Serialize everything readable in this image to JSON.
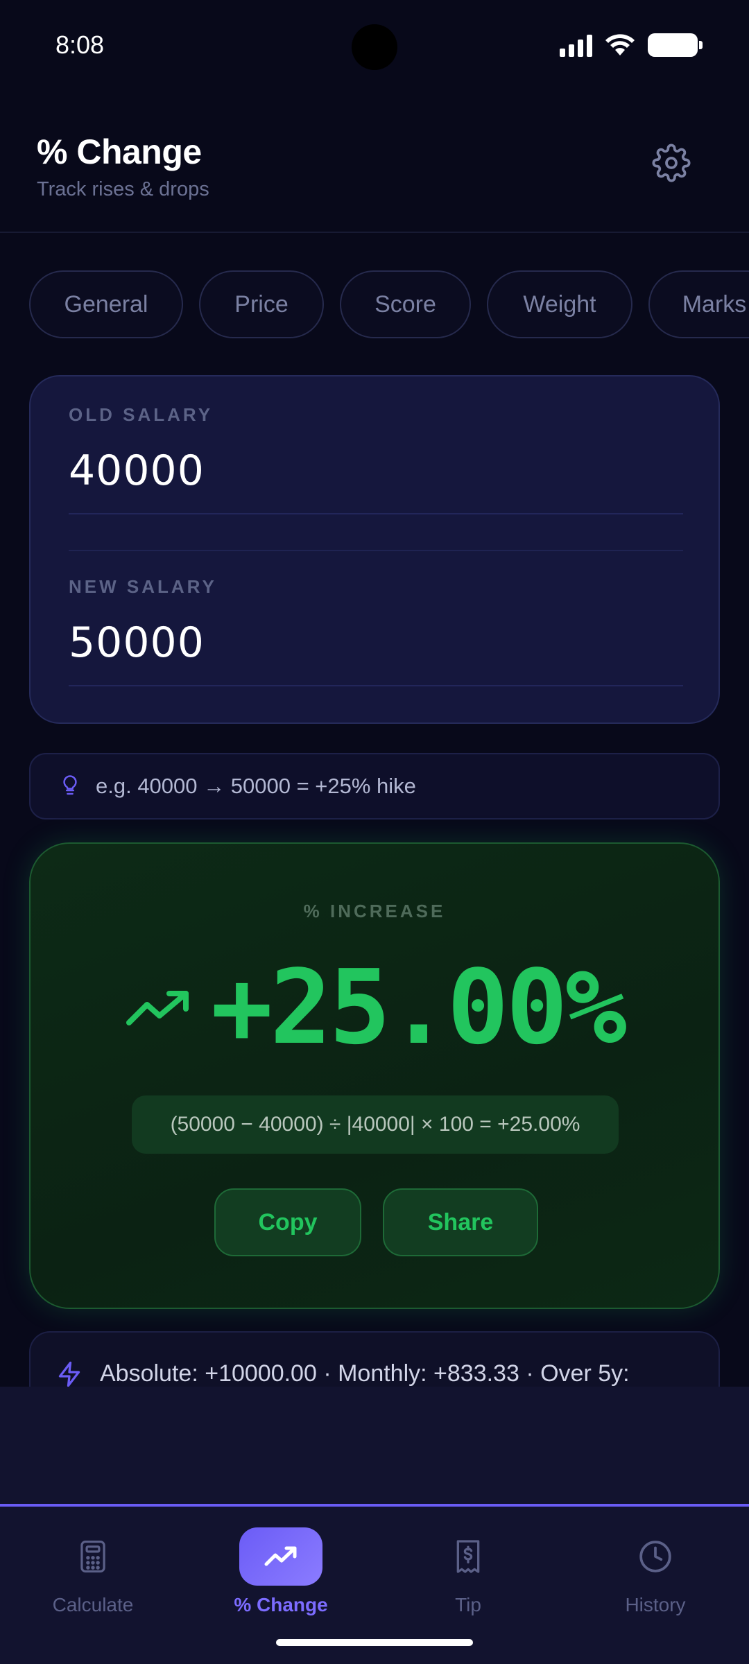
{
  "status_bar": {
    "time": "8:08"
  },
  "header": {
    "title": "% Change",
    "subtitle": "Track rises & drops"
  },
  "chips": [
    "General",
    "Price",
    "Score",
    "Weight",
    "Marks"
  ],
  "inputs": {
    "old": {
      "label": "OLD SALARY",
      "value": "40000"
    },
    "new": {
      "label": "NEW SALARY",
      "value": "50000"
    }
  },
  "hint": {
    "text": "e.g. 40000 → 50000 = +25% hike"
  },
  "result": {
    "label": "% INCREASE",
    "value": "+25.00%",
    "formula": "(50000 − 40000) ÷ |40000| × 100 = +25.00%",
    "copy_label": "Copy",
    "share_label": "Share",
    "color": "#22c55e"
  },
  "info": {
    "text": "Absolute: +10000.00 · Monthly: +833.33 · Over 5y:"
  },
  "nav": {
    "items": [
      {
        "label": "Calculate",
        "icon": "calculator-icon",
        "active": false
      },
      {
        "label": "% Change",
        "icon": "trending-up-icon",
        "active": true
      },
      {
        "label": "Tip",
        "icon": "receipt-icon",
        "active": false
      },
      {
        "label": "History",
        "icon": "clock-icon",
        "active": false
      }
    ],
    "accent": "#6b5cf6"
  }
}
